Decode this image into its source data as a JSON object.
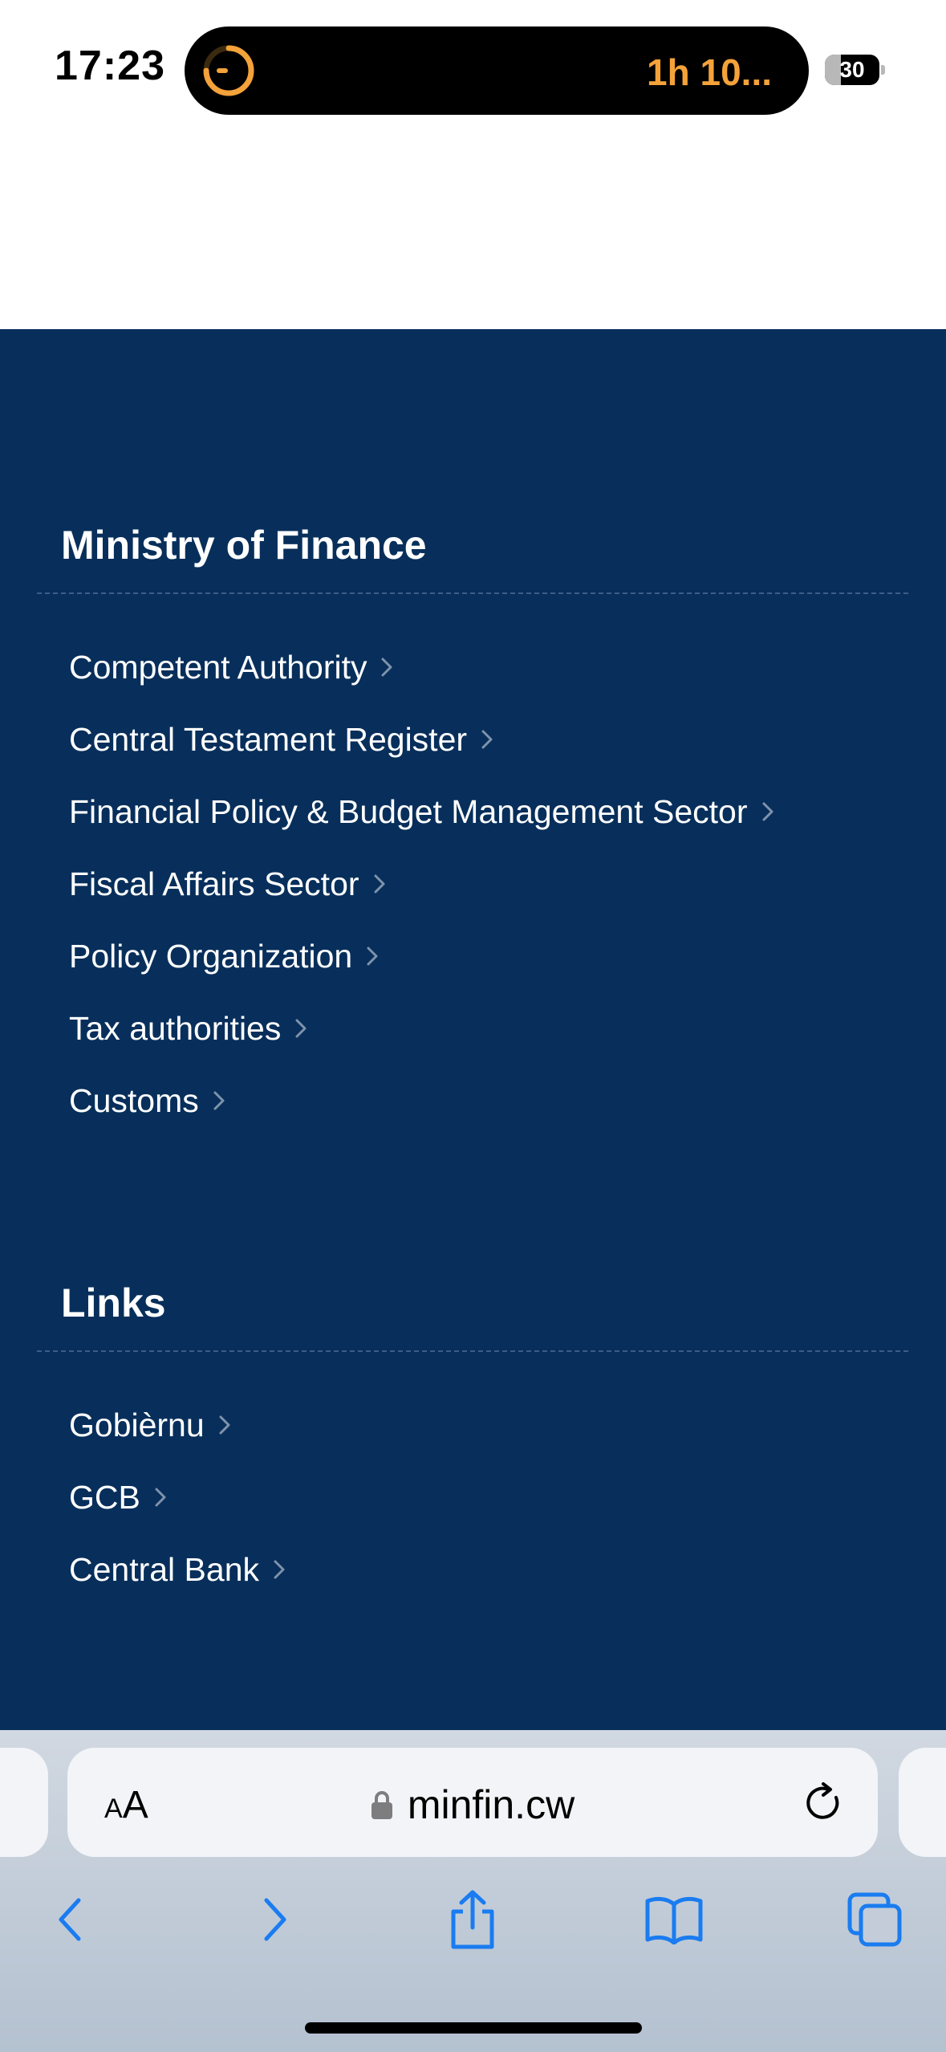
{
  "status_bar": {
    "time": "17:23",
    "timer_text": "1h 10...",
    "battery_level": "30",
    "battery_fraction": 0.3
  },
  "footer": {
    "ministry": {
      "title": "Ministry of Finance",
      "links": [
        {
          "label": "Competent Authority"
        },
        {
          "label": "Central Testament Register"
        },
        {
          "label": "Financial Policy & Budget Management Sector"
        },
        {
          "label": "Fiscal Affairs Sector"
        },
        {
          "label": "Policy Organization"
        },
        {
          "label": "Tax authorities"
        },
        {
          "label": "Customs"
        }
      ]
    },
    "links_section": {
      "title": "Links",
      "links": [
        {
          "label": "Gobièrnu"
        },
        {
          "label": "GCB"
        },
        {
          "label": "Central Bank"
        }
      ]
    }
  },
  "browser": {
    "text_size_small": "A",
    "text_size_big": "A",
    "url": "minfin.cw",
    "accent_color": "#1a7cf0"
  },
  "colors": {
    "footer_background": "#082f5b",
    "timer_orange": "#f4a23a"
  }
}
